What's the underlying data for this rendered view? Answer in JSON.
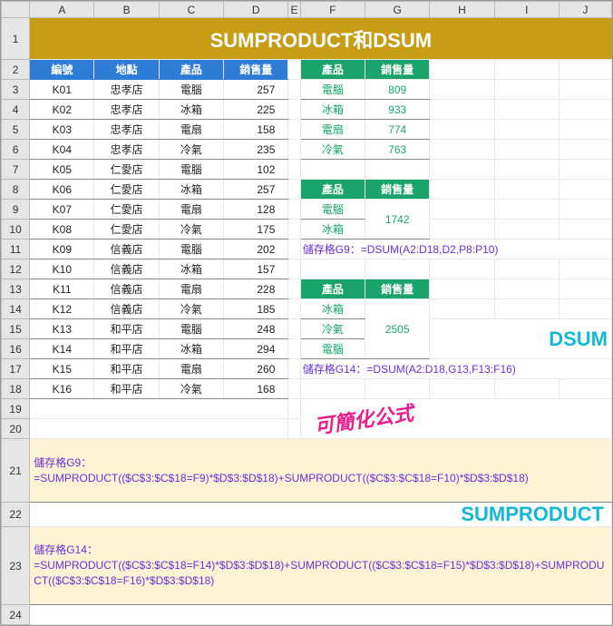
{
  "title": "SUMPRODUCT和DSUM",
  "cols": [
    "A",
    "B",
    "C",
    "D",
    "E",
    "F",
    "G",
    "H",
    "I",
    "J"
  ],
  "hdr": {
    "id": "編號",
    "loc": "地點",
    "prod": "產品",
    "sales": "銷售量"
  },
  "rows": [
    {
      "id": "K01",
      "loc": "忠孝店",
      "prod": "電腦",
      "sales": "257"
    },
    {
      "id": "K02",
      "loc": "忠孝店",
      "prod": "冰箱",
      "sales": "225"
    },
    {
      "id": "K03",
      "loc": "忠孝店",
      "prod": "電扇",
      "sales": "158"
    },
    {
      "id": "K04",
      "loc": "忠孝店",
      "prod": "冷氣",
      "sales": "235"
    },
    {
      "id": "K05",
      "loc": "仁愛店",
      "prod": "電腦",
      "sales": "102"
    },
    {
      "id": "K06",
      "loc": "仁愛店",
      "prod": "冰箱",
      "sales": "257"
    },
    {
      "id": "K07",
      "loc": "仁愛店",
      "prod": "電扇",
      "sales": "128"
    },
    {
      "id": "K08",
      "loc": "仁愛店",
      "prod": "冷氣",
      "sales": "175"
    },
    {
      "id": "K09",
      "loc": "信義店",
      "prod": "電腦",
      "sales": "202"
    },
    {
      "id": "K10",
      "loc": "信義店",
      "prod": "冰箱",
      "sales": "157"
    },
    {
      "id": "K11",
      "loc": "信義店",
      "prod": "電扇",
      "sales": "228"
    },
    {
      "id": "K12",
      "loc": "信義店",
      "prod": "冷氣",
      "sales": "185"
    },
    {
      "id": "K13",
      "loc": "和平店",
      "prod": "電腦",
      "sales": "248"
    },
    {
      "id": "K14",
      "loc": "和平店",
      "prod": "冰箱",
      "sales": "294"
    },
    {
      "id": "K15",
      "loc": "和平店",
      "prod": "電扇",
      "sales": "260"
    },
    {
      "id": "K16",
      "loc": "和平店",
      "prod": "冷氣",
      "sales": "168"
    }
  ],
  "sum1": [
    {
      "p": "電腦",
      "v": "809"
    },
    {
      "p": "冰箱",
      "v": "933"
    },
    {
      "p": "電扇",
      "v": "774"
    },
    {
      "p": "冷氣",
      "v": "763"
    }
  ],
  "sum2": {
    "prods": [
      "電腦",
      "冰箱"
    ],
    "v": "1742"
  },
  "sum3": {
    "prods": [
      "冰箱",
      "冷氣",
      "電腦"
    ],
    "v": "2505"
  },
  "f1": "儲存格G9：=DSUM(A2:D18,D2,P8:P10)",
  "f2": "儲存格G14：=DSUM(A2:D18,G13,F13:F16)",
  "lbl_dsum": "DSUM",
  "lbl_simp": "可簡化公式",
  "lbl_sp": "SUMPRODUCT",
  "box1_t": "儲存格G9：",
  "box1_f": "=SUMPRODUCT(($C$3:$C$18=F9)*$D$3:$D$18)+SUMPRODUCT(($C$3:$C$18=F10)*$D$3:$D$18)",
  "box2_t": "儲存格G14：",
  "box2_f": "=SUMPRODUCT(($C$3:$C$18=F14)*$D$3:$D$18)+SUMPRODUCT(($C$3:$C$18=F15)*$D$3:$D$18)+SUMPRODUCT(($C$3:$C$18=F16)*$D$3:$D$18)"
}
